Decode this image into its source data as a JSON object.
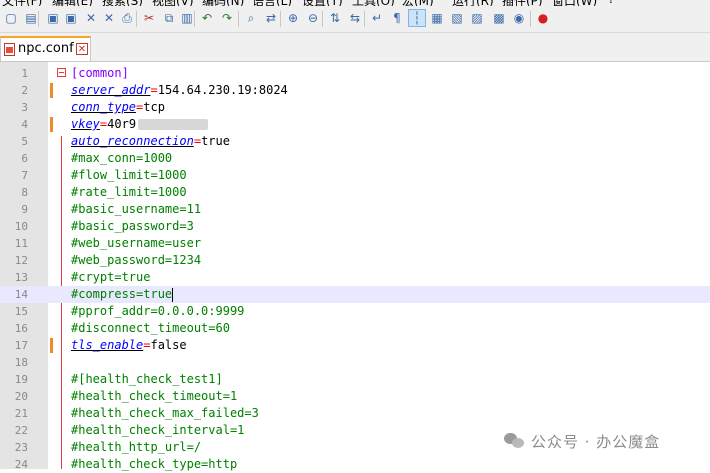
{
  "menu": [
    "文件(F)",
    "编辑(E)",
    "搜索(S)",
    "视图(V)",
    "编码(N)",
    "语言(L)",
    "设置(T)",
    "工具(O)",
    "宏(M)",
    "运行(R)",
    "插件(P)",
    "窗口(W)",
    "?"
  ],
  "toolbar": {
    "icons": [
      "new-file-icon",
      "open-file-icon",
      "save-icon",
      "save-all-icon",
      "close-icon",
      "close-all-icon",
      "print-icon",
      "cut-icon",
      "copy-icon",
      "paste-icon",
      "undo-icon",
      "redo-icon",
      "find-icon",
      "replace-icon",
      "zoom-in-icon",
      "zoom-out-icon",
      "sync-vertical-icon",
      "sync-horizontal-icon",
      "word-wrap-icon",
      "show-all-chars-icon",
      "indent-guide-icon",
      "language-icon",
      "doc-map-icon",
      "function-list-icon",
      "folder-workspace-icon",
      "monitor-icon",
      "record-macro-icon"
    ],
    "glyphs": [
      "▢",
      "▤",
      "▣",
      "▣",
      "✕",
      "✕",
      "⎙",
      "✂",
      "⧉",
      "▥",
      "↶",
      "↷",
      "⌕",
      "⇄",
      "⊕",
      "⊖",
      "⇅",
      "⇆",
      "↵",
      "¶",
      "┆",
      "▦",
      "▧",
      "▨",
      "▩",
      "◉",
      "●"
    ],
    "active": "indent-guide-icon"
  },
  "tab": {
    "label": "npc.conf",
    "close": "✕"
  },
  "lines": [
    {
      "n": "1",
      "type": "section",
      "text": "[common]",
      "fold": true
    },
    {
      "n": "2",
      "type": "kv",
      "key": "server_addr",
      "val": "154.64.230.19:8024",
      "marker": true
    },
    {
      "n": "3",
      "type": "kv",
      "key": "conn_type",
      "val": "tcp"
    },
    {
      "n": "4",
      "type": "kv",
      "key": "vkey",
      "val": "40r9",
      "redacted": true,
      "marker": true
    },
    {
      "n": "5",
      "type": "kv",
      "key": "auto_reconnection",
      "val": "true"
    },
    {
      "n": "6",
      "type": "comment",
      "text": "#max_conn=1000"
    },
    {
      "n": "7",
      "type": "comment",
      "text": "#flow_limit=1000"
    },
    {
      "n": "8",
      "type": "comment",
      "text": "#rate_limit=1000"
    },
    {
      "n": "9",
      "type": "comment",
      "text": "#basic_username=11"
    },
    {
      "n": "10",
      "type": "comment",
      "text": "#basic_password=3"
    },
    {
      "n": "11",
      "type": "comment",
      "text": "#web_username=user"
    },
    {
      "n": "12",
      "type": "comment",
      "text": "#web_password=1234"
    },
    {
      "n": "13",
      "type": "comment",
      "text": "#crypt=true"
    },
    {
      "n": "14",
      "type": "comment",
      "text": "#compress=true",
      "current": true
    },
    {
      "n": "15",
      "type": "comment",
      "text": "#pprof_addr=0.0.0.0:9999"
    },
    {
      "n": "16",
      "type": "comment",
      "text": "#disconnect_timeout=60"
    },
    {
      "n": "17",
      "type": "kv",
      "key": "tls_enable",
      "val": "false",
      "marker": true
    },
    {
      "n": "18",
      "type": "blank",
      "text": ""
    },
    {
      "n": "19",
      "type": "comment",
      "text": "#[health_check_test1]"
    },
    {
      "n": "20",
      "type": "comment",
      "text": "#health_check_timeout=1"
    },
    {
      "n": "21",
      "type": "comment",
      "text": "#health_check_max_failed=3"
    },
    {
      "n": "22",
      "type": "comment",
      "text": "#health_check_interval=1"
    },
    {
      "n": "23",
      "type": "comment",
      "text": "#health_http_url=/"
    },
    {
      "n": "24",
      "type": "comment",
      "text": "#health_check_type=http"
    }
  ],
  "watermark": {
    "text": "公众号 · 办公魔盒",
    "icon": "wechat-icon"
  },
  "colors": {
    "section": "#8000ff",
    "key": "#0000ff",
    "equals": "#ff0000",
    "comment": "#008000",
    "tab_accent": "#f5a623",
    "gutter_marker": "#f08a24"
  }
}
